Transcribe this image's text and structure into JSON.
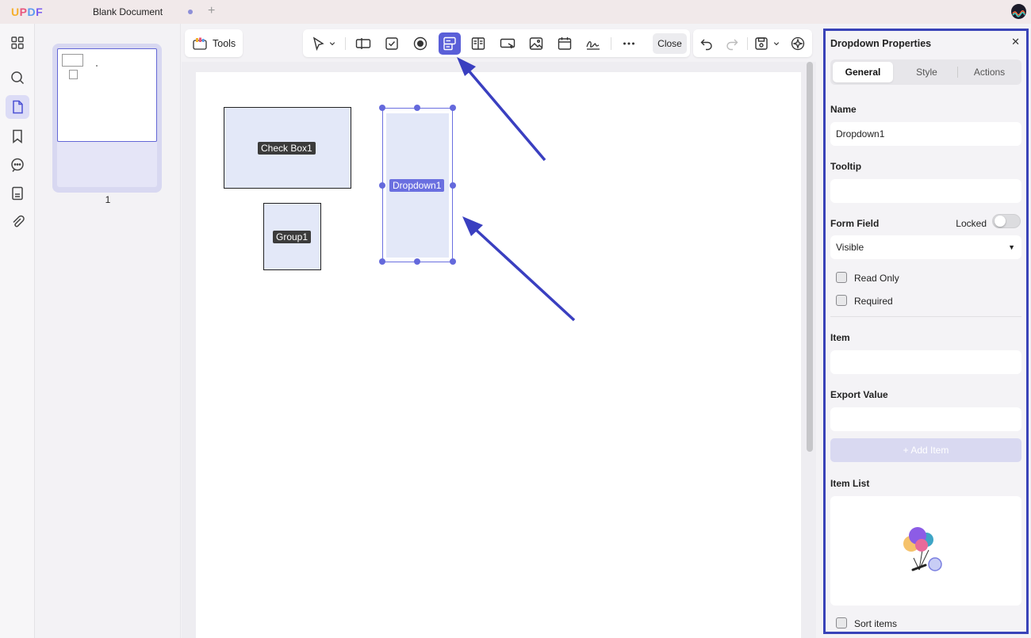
{
  "app": {
    "logo": "UPDF",
    "logo_colors": [
      "#f5b02e",
      "#e8567e",
      "#5b9bf0",
      "#7a5cf0"
    ],
    "document_title": "Blank Document"
  },
  "toolbar": {
    "tools_label": "Tools",
    "close_label": "Close"
  },
  "thumbnails": {
    "page_number": "1"
  },
  "canvas": {
    "fields": {
      "checkbox": "Check Box1",
      "group": "Group1",
      "dropdown": "Dropdown1"
    }
  },
  "panel": {
    "title": "Dropdown Properties",
    "tabs": [
      "General",
      "Style",
      "Actions"
    ],
    "name_label": "Name",
    "name_value": "Dropdown1",
    "tooltip_label": "Tooltip",
    "tooltip_value": "",
    "form_field_label": "Form Field",
    "locked_label": "Locked",
    "visibility_value": "Visible",
    "read_only_label": "Read Only",
    "required_label": "Required",
    "item_label": "Item",
    "item_value": "",
    "export_value_label": "Export Value",
    "export_value": "",
    "add_item_label": "+ Add Item",
    "item_list_label": "Item List",
    "sort_items_label": "Sort items"
  },
  "colors": {
    "accent": "#5a5fd8",
    "panel_border": "#3943b8",
    "arrow": "#3a3fc0"
  }
}
